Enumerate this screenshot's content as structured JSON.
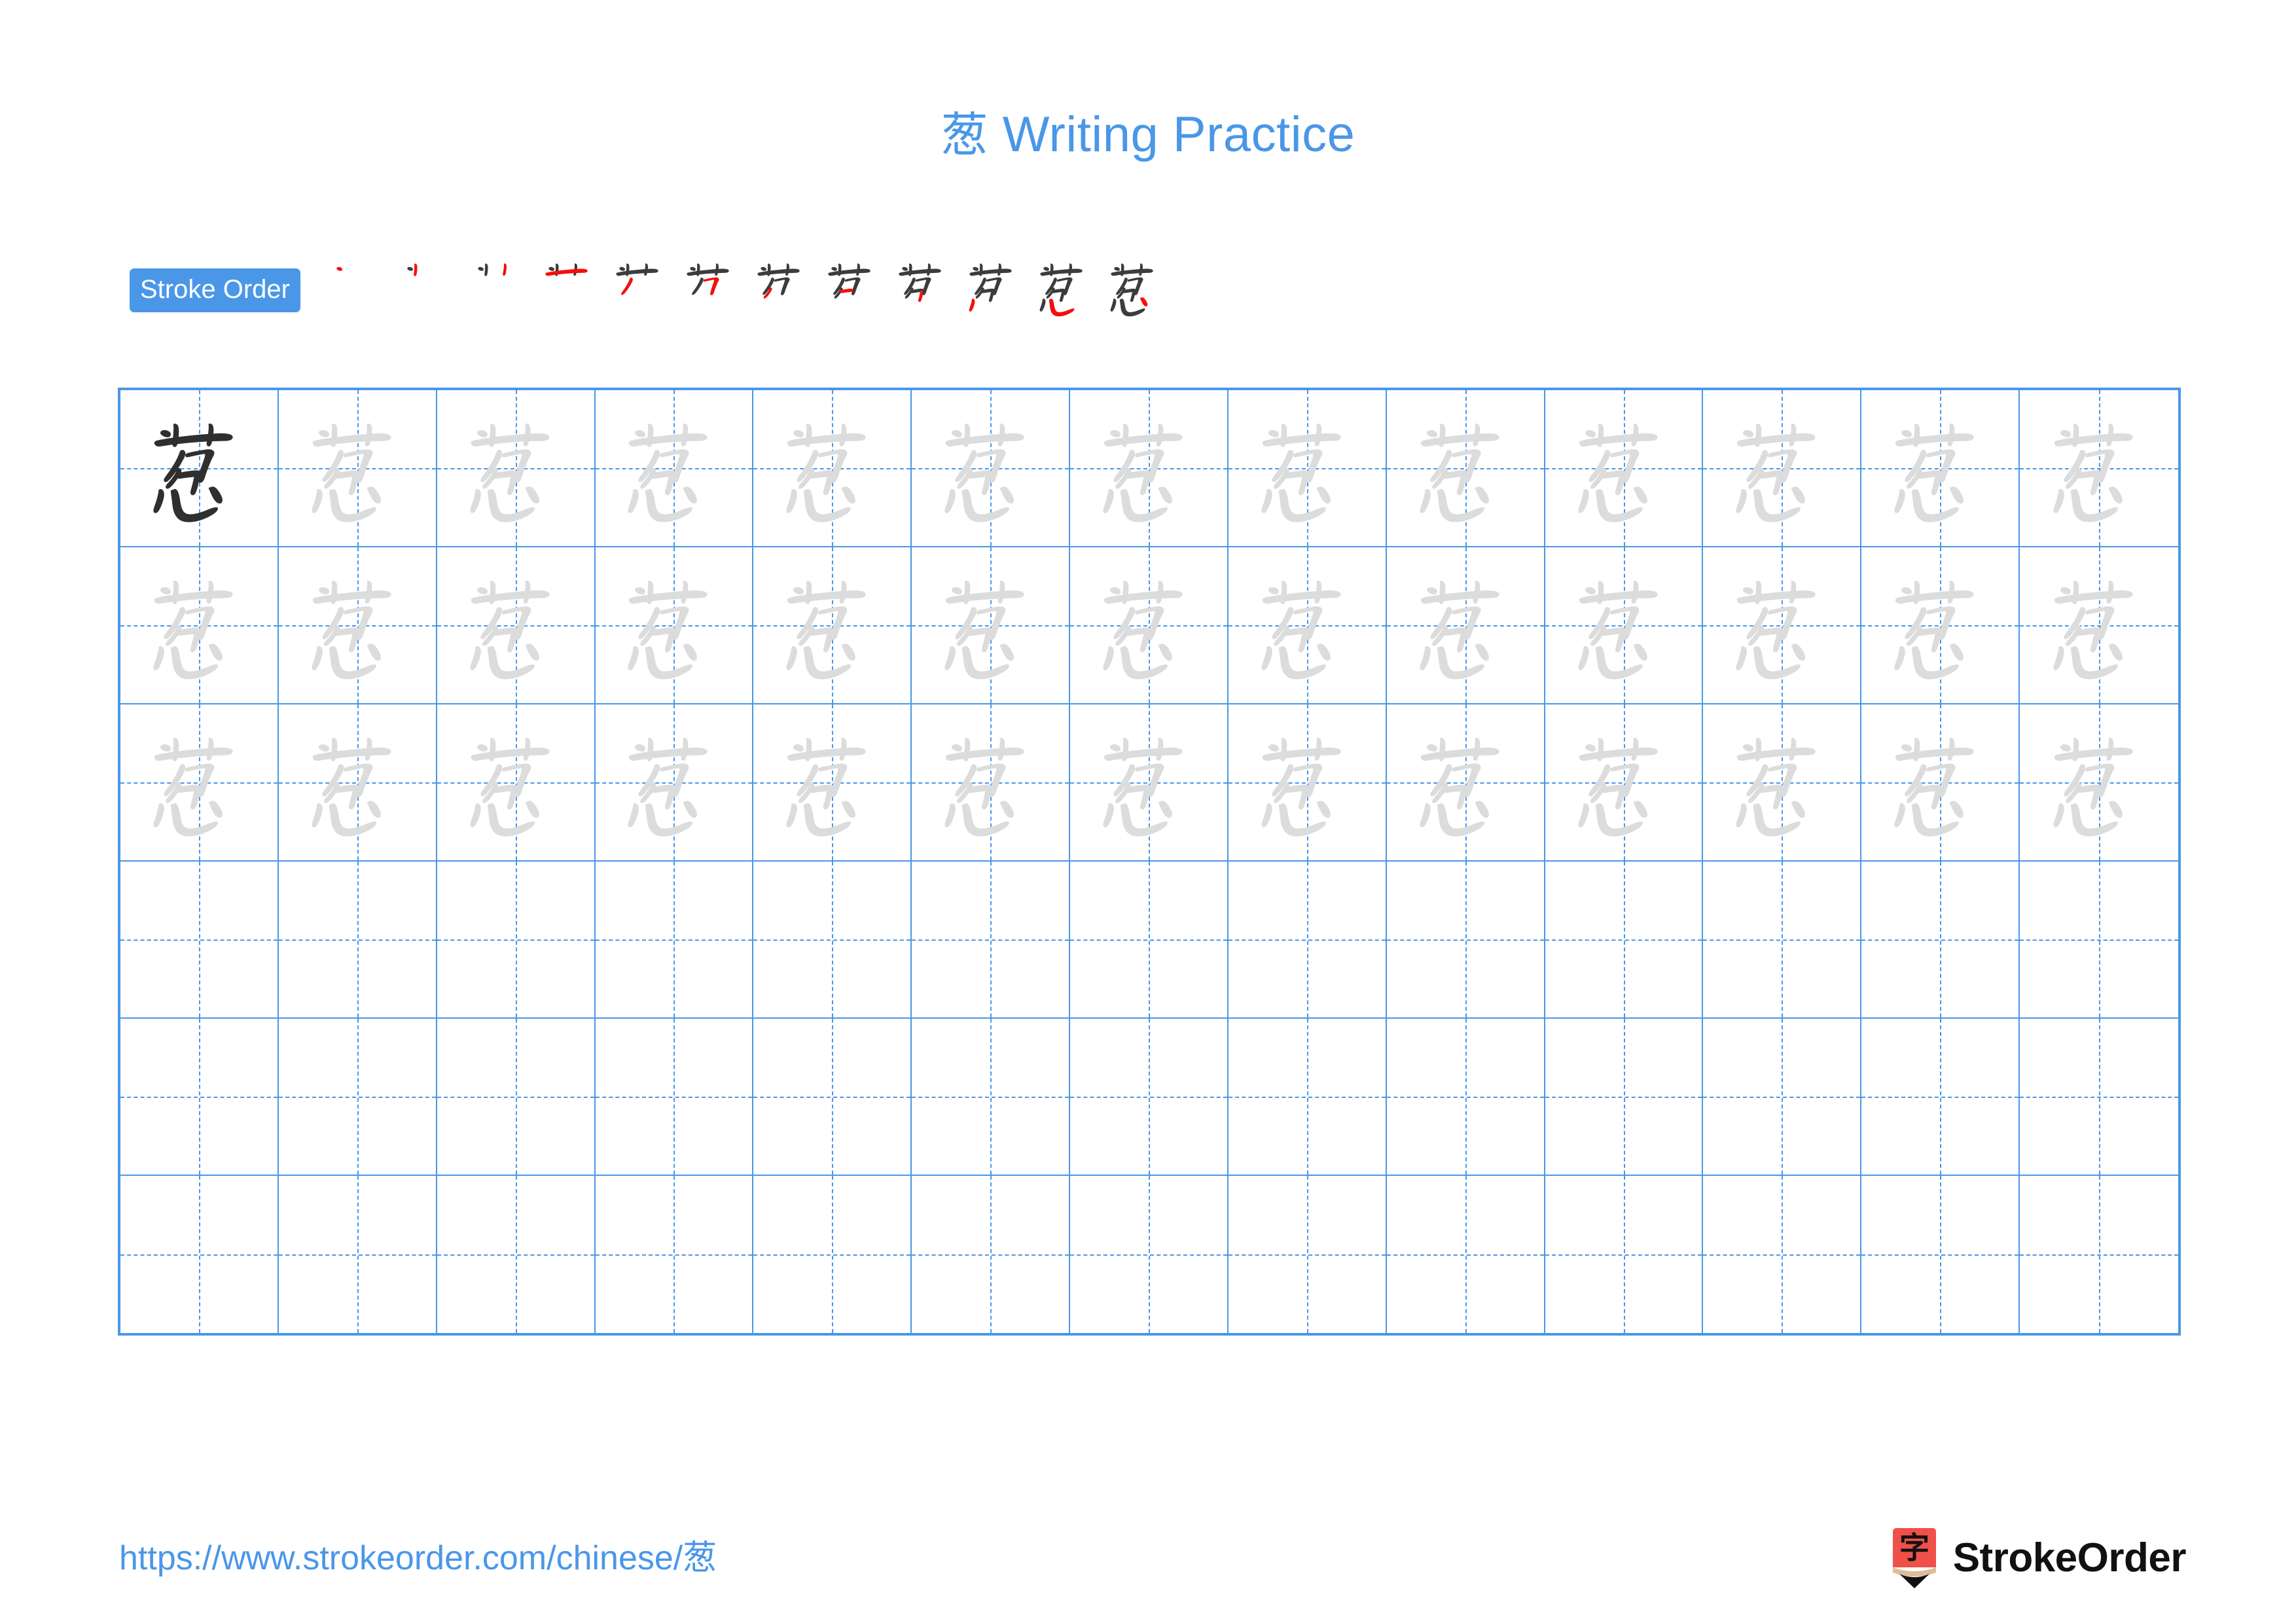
{
  "page": {
    "character": "葱",
    "title": "葱 Writing Practice",
    "title_char": "葱",
    "title_text": " Writing Practice",
    "background_color": "#ffffff",
    "accent_color": "#4a97e8",
    "model_char_color": "#2f2f2f",
    "trace_char_color": "#dcdcdc",
    "new_stroke_color": "#f40f0f",
    "old_stroke_color": "#3c3c3c"
  },
  "stroke_order": {
    "badge_label": "Stroke Order",
    "total_strokes": 12,
    "steps": [
      {
        "index": 1,
        "strokes_shown": 1,
        "new_stroke_color": "#f40f0f"
      },
      {
        "index": 2,
        "strokes_shown": 2,
        "new_stroke_color": "#f40f0f"
      },
      {
        "index": 3,
        "strokes_shown": 3,
        "new_stroke_color": "#f40f0f"
      },
      {
        "index": 4,
        "strokes_shown": 4,
        "new_stroke_color": "#f40f0f"
      },
      {
        "index": 5,
        "strokes_shown": 5,
        "new_stroke_color": "#f40f0f"
      },
      {
        "index": 6,
        "strokes_shown": 6,
        "new_stroke_color": "#f40f0f"
      },
      {
        "index": 7,
        "strokes_shown": 7,
        "new_stroke_color": "#f40f0f"
      },
      {
        "index": 8,
        "strokes_shown": 8,
        "new_stroke_color": "#f40f0f"
      },
      {
        "index": 9,
        "strokes_shown": 9,
        "new_stroke_color": "#f40f0f"
      },
      {
        "index": 10,
        "strokes_shown": 10,
        "new_stroke_color": "#f40f0f"
      },
      {
        "index": 11,
        "strokes_shown": 11,
        "new_stroke_color": "#f40f0f"
      },
      {
        "index": 12,
        "strokes_shown": 12,
        "new_stroke_color": "#f40f0f"
      }
    ]
  },
  "practice_grid": {
    "columns": 13,
    "rows": 6,
    "grid_line_color": "#4a97e8",
    "cells": [
      [
        "model",
        "trace",
        "trace",
        "trace",
        "trace",
        "trace",
        "trace",
        "trace",
        "trace",
        "trace",
        "trace",
        "trace",
        "trace"
      ],
      [
        "trace",
        "trace",
        "trace",
        "trace",
        "trace",
        "trace",
        "trace",
        "trace",
        "trace",
        "trace",
        "trace",
        "trace",
        "trace"
      ],
      [
        "trace",
        "trace",
        "trace",
        "trace",
        "trace",
        "trace",
        "trace",
        "trace",
        "trace",
        "trace",
        "trace",
        "trace",
        "trace"
      ],
      [
        "empty",
        "empty",
        "empty",
        "empty",
        "empty",
        "empty",
        "empty",
        "empty",
        "empty",
        "empty",
        "empty",
        "empty",
        "empty"
      ],
      [
        "empty",
        "empty",
        "empty",
        "empty",
        "empty",
        "empty",
        "empty",
        "empty",
        "empty",
        "empty",
        "empty",
        "empty",
        "empty"
      ],
      [
        "empty",
        "empty",
        "empty",
        "empty",
        "empty",
        "empty",
        "empty",
        "empty",
        "empty",
        "empty",
        "empty",
        "empty",
        "empty"
      ]
    ]
  },
  "footer": {
    "url_prefix": "https://www.strokeorder.com/chinese/",
    "url_char": "葱",
    "url_full": "https://www.strokeorder.com/chinese/葱",
    "brand_name": "StrokeOrder",
    "logo_char": "字",
    "logo_body_color": "#f0504a",
    "logo_wood_color": "#e0bd98",
    "logo_tip_color": "#111111"
  }
}
